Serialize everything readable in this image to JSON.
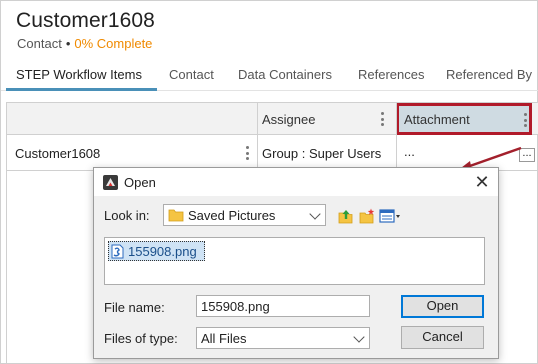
{
  "header": {
    "title": "Customer1608",
    "object_type": "Contact",
    "separator": "•",
    "completion": "0% Complete"
  },
  "tabs": [
    {
      "label": "STEP Workflow Items",
      "active": true
    },
    {
      "label": "Contact",
      "active": false
    },
    {
      "label": "Data Containers",
      "active": false
    },
    {
      "label": "References",
      "active": false
    },
    {
      "label": "Referenced By",
      "active": false
    }
  ],
  "grid": {
    "columns": [
      "",
      "Assignee",
      "Attachment"
    ],
    "rows": [
      {
        "name": "Customer1608",
        "assignee": "Group : Super Users",
        "attachment": "...",
        "attachment_button": "..."
      }
    ]
  },
  "dialog": {
    "title": "Open",
    "close_glyph": "✕",
    "look_in_label": "Look in:",
    "look_in_value": "Saved Pictures",
    "files": [
      {
        "name": "155908.png",
        "selected": true
      }
    ],
    "file_name_label": "File name:",
    "file_name_value": "155908.png",
    "files_of_type_label": "Files of type:",
    "files_of_type_value": "All Files",
    "open_button": "Open",
    "cancel_button": "Cancel"
  },
  "colors": {
    "accent": "#4a90b8",
    "completion": "#f08a00",
    "highlight_border": "#b11a2a",
    "arrow": "#a3202c"
  },
  "icons": {
    "dialog_app": "java-app-icon",
    "folder": "folder-icon",
    "up_folder": "up-one-level-icon",
    "new_folder": "new-folder-icon",
    "view_menu": "view-menu-icon",
    "file": "image-file-icon"
  }
}
